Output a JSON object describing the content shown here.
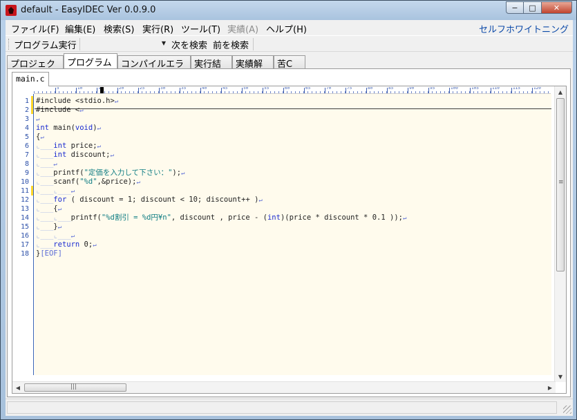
{
  "window": {
    "title": "default - EasyIDEC Ver 0.0.9.0",
    "minimize": "−",
    "maximize": "□",
    "close": "✕"
  },
  "menu": [
    {
      "label": "ファイル(F)",
      "enabled": true
    },
    {
      "label": "編集(E)",
      "enabled": true
    },
    {
      "label": "検索(S)",
      "enabled": true
    },
    {
      "label": "実行(R)",
      "enabled": true
    },
    {
      "label": "ツール(T)",
      "enabled": true
    },
    {
      "label": "実績(A)",
      "enabled": false
    },
    {
      "label": "ヘルプ(H)",
      "enabled": true
    }
  ],
  "theme_label": "セルフホワイトニング",
  "toolbar": {
    "run_label": "プログラム実行",
    "combo_arrow": "▼",
    "find_next": "次を検索",
    "find_prev": "前を検索"
  },
  "tabs": [
    {
      "label": "プロジェクト",
      "active": false
    },
    {
      "label": "プログラム",
      "active": true
    },
    {
      "label": "コンパイルエラー",
      "active": false
    },
    {
      "label": "実行結果",
      "active": false
    },
    {
      "label": "実績解除",
      "active": false
    },
    {
      "label": "苦C",
      "active": false
    }
  ],
  "file_tab": "main.c",
  "ruler_numbers": [
    "5",
    "10",
    "15",
    "20",
    "25",
    "30",
    "35",
    "40",
    "45",
    "50",
    "55",
    "60",
    "65",
    "70",
    "75",
    "80",
    "85",
    "90",
    "95",
    "100",
    "105",
    "110",
    "115",
    "120"
  ],
  "line_numbers": [
    "1",
    "2",
    "3",
    "4",
    "5",
    "6",
    "7",
    "8",
    "9",
    "10",
    "11",
    "12",
    "13",
    "14",
    "15",
    "16",
    "17",
    "18"
  ],
  "code_lines": [
    "#include <stdio.h>",
    "#include <",
    "",
    "int main(void)",
    "{",
    "\tint price;",
    "\tint discount;",
    "\t",
    "\tprintf(\"定価を入力して下さい：\");",
    "\tscanf(\"%d\",&price);",
    "\t\t",
    "\tfor ( discount = 1; discount < 10; discount++ )",
    "\t{",
    "\t\tprintf(\"%d割引 = %d円¥n\", discount , price - (int)(price * discount * 0.1 ));",
    "\t}",
    "\t\t",
    "\treturn 0;",
    "}[EOF]"
  ],
  "colors": {
    "keyword": "#1b2bd1",
    "string": "#0f7d83",
    "line_number": "#2a4ea8",
    "editor_bg": "#fffbed",
    "modified_marker": "#ffd82a"
  },
  "scrollbar": {
    "up": "▲",
    "down": "▼",
    "left": "◀",
    "right": "▶",
    "grip": "≡",
    "grip_h": "|||"
  }
}
